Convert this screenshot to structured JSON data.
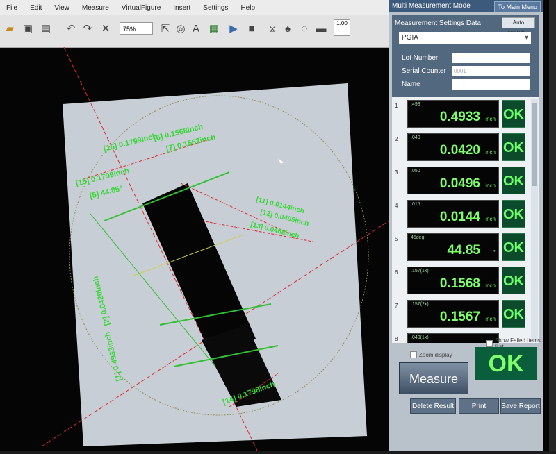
{
  "menu": [
    "File",
    "Edit",
    "View",
    "Measure",
    "VirtualFigure",
    "Insert",
    "Settings",
    "Help"
  ],
  "toolbar": {
    "zoom": "75%",
    "line_width": "1.00"
  },
  "canvas": {
    "annotations": [
      {
        "id": "16",
        "label": "[16] 0.1799inch"
      },
      {
        "id": "6",
        "label": "[6] 0.1568inch"
      },
      {
        "id": "7",
        "label": "[7] 0.1567inch"
      },
      {
        "id": "15",
        "label": "[15] 0.1799inch"
      },
      {
        "id": "5",
        "label": "[5] 44.85°"
      },
      {
        "id": "11",
        "label": "[11] 0.0144inch"
      },
      {
        "id": "12",
        "label": "[12] 0.0495inch"
      },
      {
        "id": "13",
        "label": "[13] 0.0468inch"
      },
      {
        "id": "1",
        "label": "[1] 0.4933inch"
      },
      {
        "id": "2",
        "label": "[2] 0.0420inch"
      },
      {
        "id": "14",
        "label": "[14] 0.1798inch"
      }
    ]
  },
  "panel": {
    "title": "Multi Measurement Mode",
    "main_menu": "To Main Menu",
    "settings_label": "Measurement Settings Data",
    "auto_search": "Auto search...",
    "selected": "PGIA",
    "fields": [
      {
        "label": "Lot Number",
        "value": ""
      },
      {
        "label": "Serial Counter",
        "value": "0001"
      },
      {
        "label": "Name",
        "value": ""
      }
    ],
    "results": [
      {
        "num": "1",
        "name": ".493",
        "value": "0.4933",
        "unit": "inch",
        "status": "OK"
      },
      {
        "num": "2",
        "name": ".040",
        "value": "0.0420",
        "unit": "inch",
        "status": "OK"
      },
      {
        "num": "3",
        "name": ".050",
        "value": "0.0496",
        "unit": "inch",
        "status": "OK"
      },
      {
        "num": "4",
        "name": ".015",
        "value": "0.0144",
        "unit": "inch",
        "status": "OK"
      },
      {
        "num": "5",
        "name": "45deg",
        "value": "44.85",
        "unit": "°",
        "status": "OK"
      },
      {
        "num": "6",
        "name": ".157(1x)",
        "value": "0.1568",
        "unit": "inch",
        "status": "OK"
      },
      {
        "num": "7",
        "name": ".157(2x)",
        "value": "0.1567",
        "unit": "inch",
        "status": "OK"
      }
    ],
    "row8": {
      "num": "8",
      "name": ".040(1x)"
    },
    "show_failed": "Show Failed Items first",
    "zoom_display": "Zoom display",
    "measure_btn": "Measure",
    "overall_status": "OK",
    "delete_btn": "Delete Result",
    "print_btn": "Print",
    "save_btn": "Save Report"
  },
  "colors": {
    "accent_green": "#7dff6a",
    "ok_bg": "#0b4a2b",
    "title_bar": "#3c5a7c"
  }
}
